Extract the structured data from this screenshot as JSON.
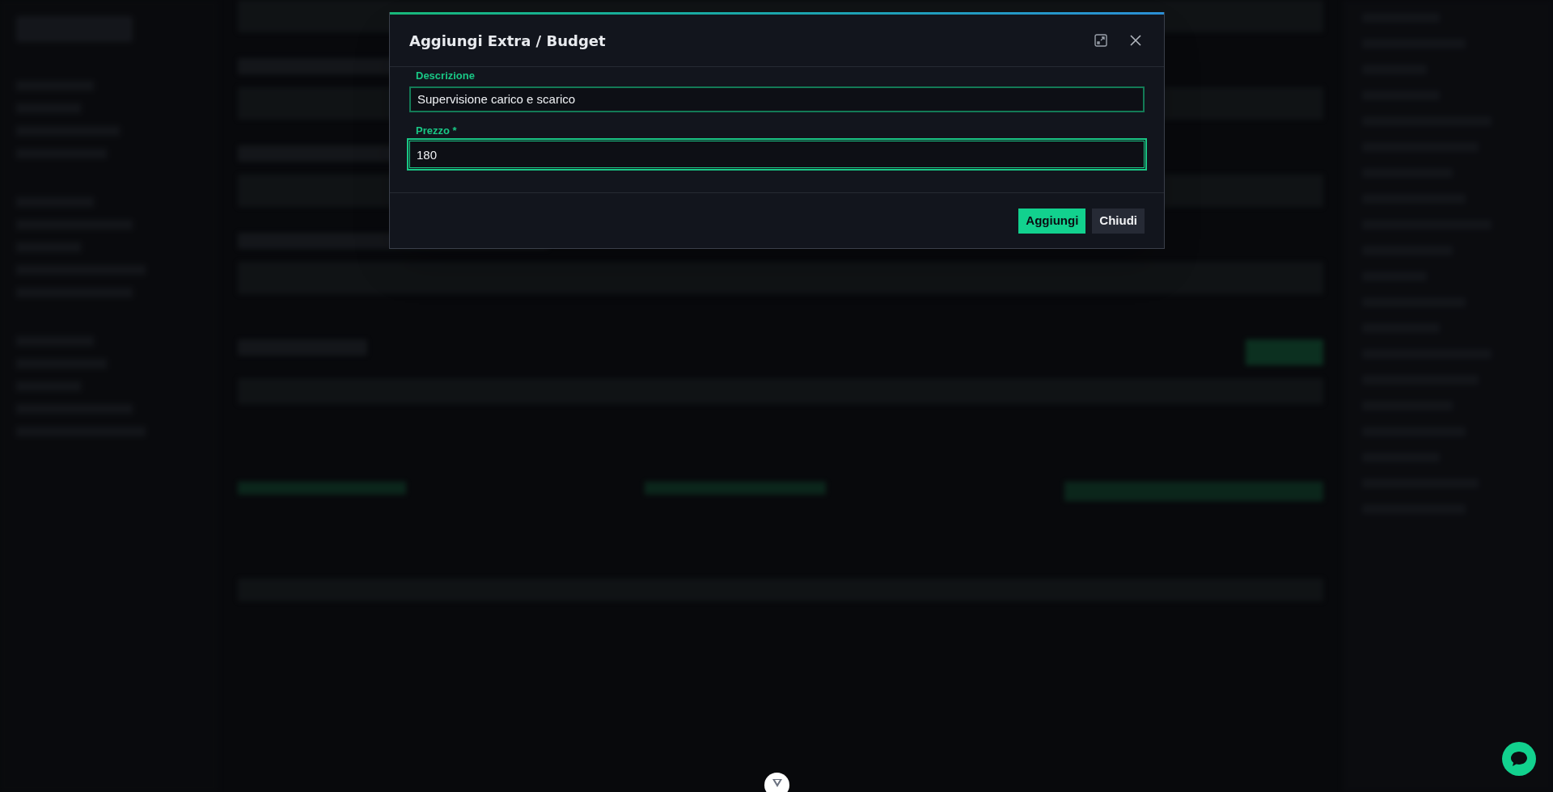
{
  "dialog": {
    "title": "Aggiungi Extra / Budget",
    "fields": [
      {
        "label": "Descrizione",
        "value": "Supervisione carico e scarico",
        "focused": false
      },
      {
        "label": "Prezzo *",
        "value": "180",
        "focused": true
      }
    ],
    "buttons": [
      {
        "label": "Aggiungi",
        "kind": "primary"
      },
      {
        "label": "Chiudi",
        "kind": "secondary"
      }
    ]
  }
}
